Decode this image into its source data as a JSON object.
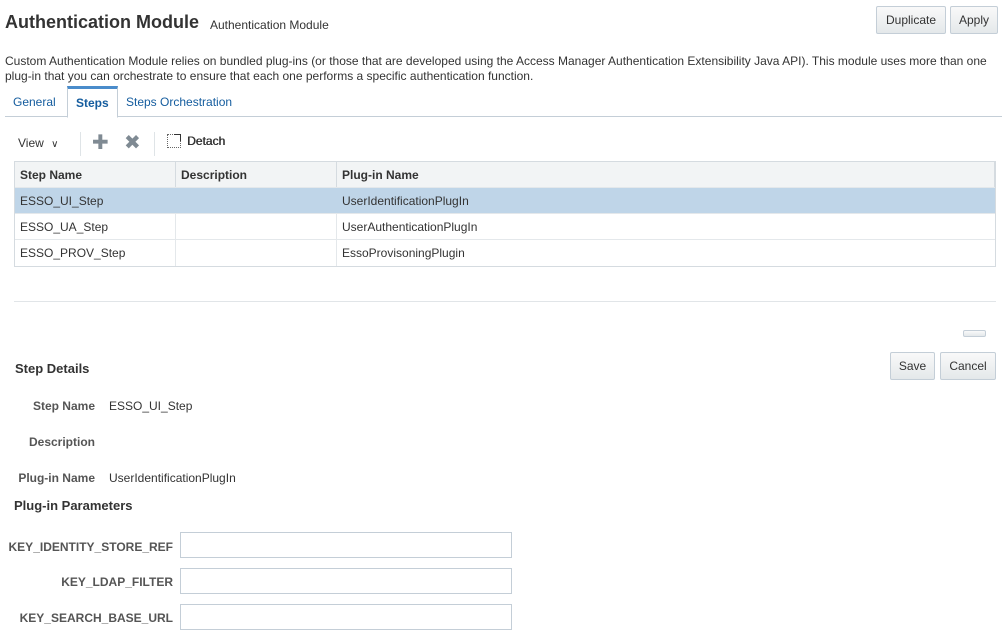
{
  "header": {
    "title": "Authentication Module",
    "subtitle": "Authentication Module",
    "duplicate_label": "Duplicate",
    "apply_label": "Apply"
  },
  "description": "Custom Authentication Module relies on bundled plug-ins (or those that are developed using the Access Manager Authentication Extensibility Java API). This module uses more than one plug-in that you can orchestrate to ensure that each one performs a specific authentication function.",
  "tabs": [
    {
      "label": "General"
    },
    {
      "label": "Steps",
      "selected": true
    },
    {
      "label": "Steps Orchestration"
    }
  ],
  "toolbar": {
    "view_label": "View",
    "detach_label": "Detach"
  },
  "table": {
    "columns": [
      "Step Name",
      "Description",
      "Plug-in Name"
    ],
    "rows": [
      {
        "step_name": "ESSO_UI_Step",
        "description": "",
        "plugin_name": "UserIdentificationPlugIn",
        "selected": true
      },
      {
        "step_name": "ESSO_UA_Step",
        "description": "",
        "plugin_name": "UserAuthenticationPlugIn"
      },
      {
        "step_name": "ESSO_PROV_Step",
        "description": "",
        "plugin_name": "EssoProvisoningPlugin"
      }
    ]
  },
  "details": {
    "section_title": "Step Details",
    "save_label": "Save",
    "cancel_label": "Cancel",
    "step_name_label": "Step Name",
    "step_name_value": "ESSO_UI_Step",
    "description_label": "Description",
    "description_value": "",
    "plugin_name_label": "Plug-in Name",
    "plugin_name_value": "UserIdentificationPlugIn"
  },
  "params": {
    "section_title": "Plug-in Parameters",
    "items": [
      {
        "label": "KEY_IDENTITY_STORE_REF",
        "value": ""
      },
      {
        "label": "KEY_LDAP_FILTER",
        "value": ""
      },
      {
        "label": "KEY_SEARCH_BASE_URL",
        "value": ""
      }
    ]
  },
  "colors": {
    "link": "#145c9e",
    "selected_row": "#bfd5e8",
    "tab_accent": "#4a8ccb"
  }
}
